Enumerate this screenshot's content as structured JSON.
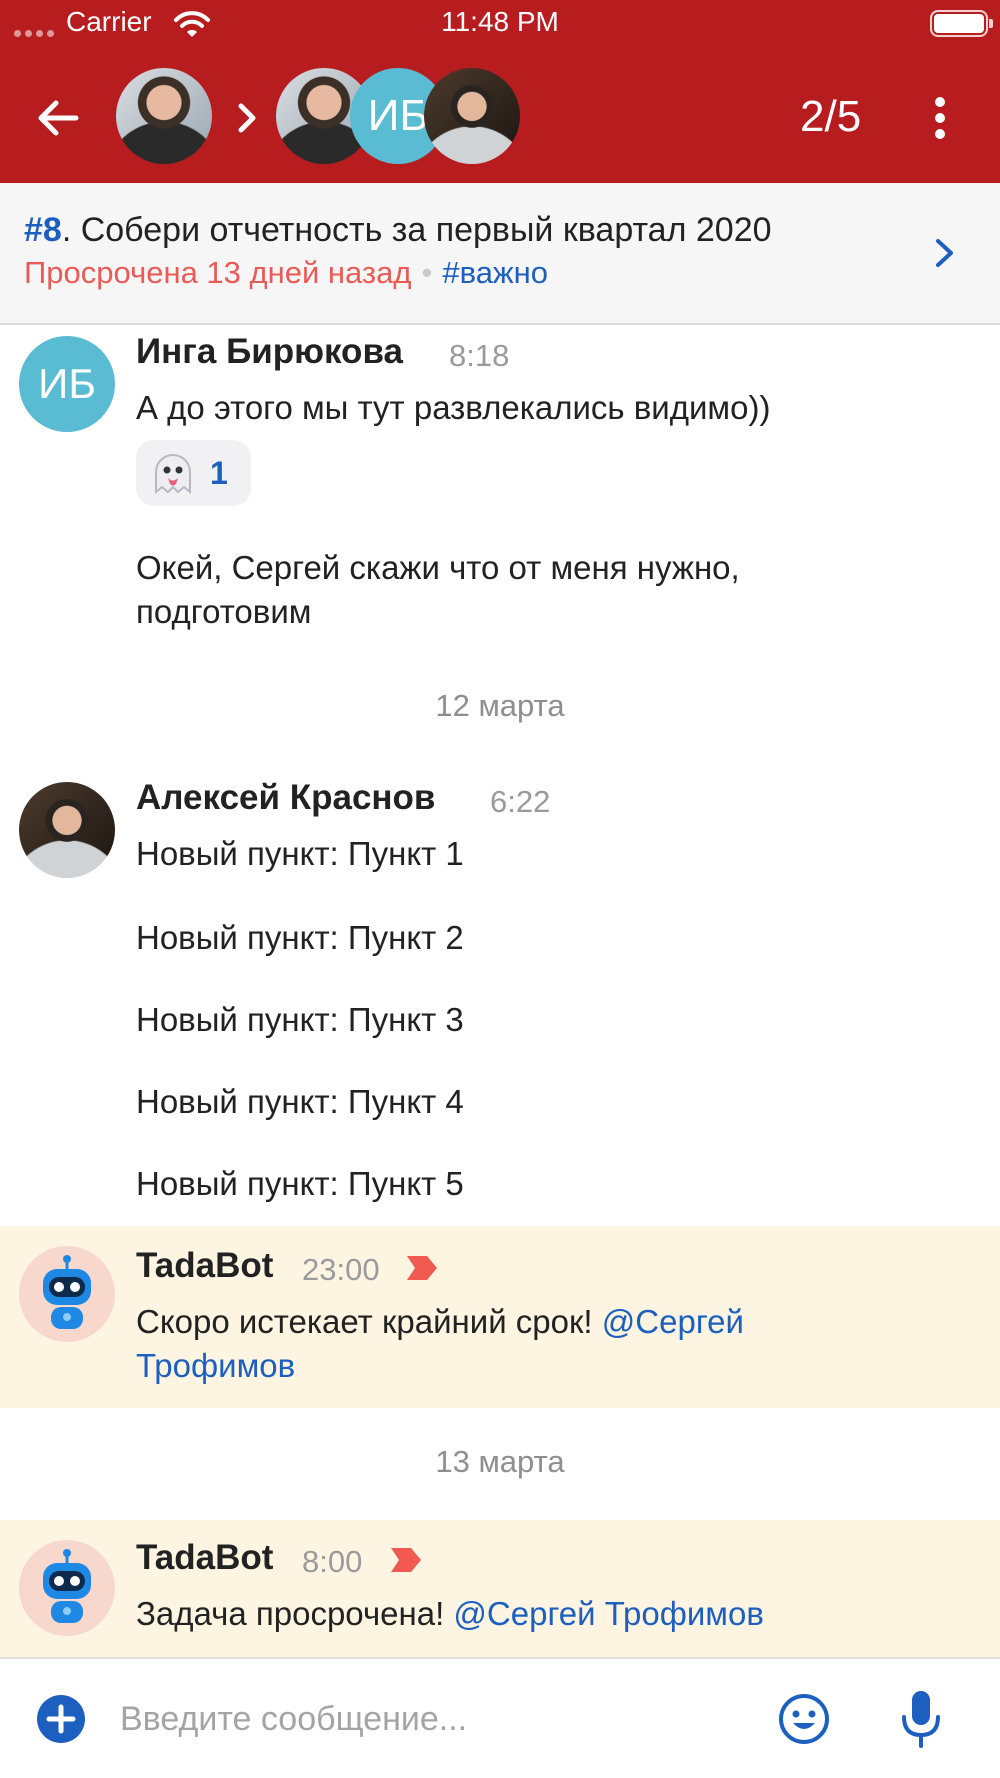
{
  "status_bar": {
    "carrier": "Carrier",
    "time": "11:48 PM"
  },
  "header": {
    "counter": "2/5",
    "assignee_initials": "ИБ"
  },
  "task": {
    "number": "#8",
    "title": ". Собери отчетность за первый квартал 2020",
    "overdue": "Просрочена 13 дней назад",
    "separator": "•",
    "tag": "#важно"
  },
  "messages": {
    "inga": {
      "initials": "ИБ",
      "name": "Инга Бирюкова",
      "time": "8:18",
      "text1": "А до этого мы тут развлекались видимо))",
      "reaction_count": "1",
      "text2_line1": "Окей, Сергей скажи что от меня нужно,",
      "text2_line2": "подготовим"
    },
    "date1": "12 марта",
    "aleksey": {
      "name": "Алексей Краснов",
      "time": "6:22",
      "items": [
        "Новый пункт: Пункт 1",
        "Новый пункт: Пункт 2",
        "Новый пункт: Пункт 3",
        "Новый пункт: Пункт 4",
        "Новый пункт: Пункт 5"
      ]
    },
    "bot1": {
      "name": "TadaBot",
      "time": "23:00",
      "text": "Скоро истекает крайний срок! ",
      "mention_line1": "@Сергей",
      "mention_line2": "Трофимов"
    },
    "date2": "13 марта",
    "bot2": {
      "name": "TadaBot",
      "time": "8:00",
      "text": "Задача просрочена! ",
      "mention": "@Сергей Трофимов"
    }
  },
  "composer": {
    "placeholder": "Введите сообщение..."
  },
  "colors": {
    "header": "#b71c1f",
    "link": "#1d5fbf",
    "overdue": "#ea5b55",
    "bot_bg": "#fdf5e2",
    "avatar_teal": "#59bcd2"
  },
  "icons": [
    "back-arrow-icon",
    "chevron-right-icon",
    "more-vertical-icon",
    "ghost-emoji-icon",
    "flag-icon",
    "robot-icon",
    "plus-circle-icon",
    "smiley-icon",
    "microphone-icon",
    "wifi-icon",
    "battery-icon"
  ]
}
